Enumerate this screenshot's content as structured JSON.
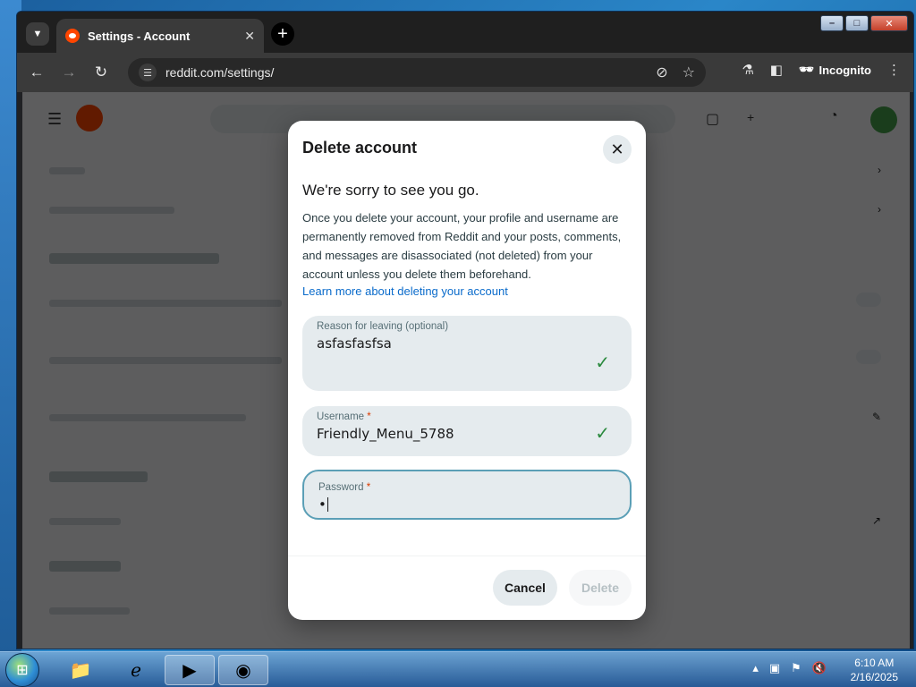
{
  "browser": {
    "tab_title": "Settings - Account",
    "tab_close_glyph": "✕",
    "new_tab_glyph": "+",
    "url": "reddit.com/settings/",
    "incognito_label": "Incognito"
  },
  "modal": {
    "title": "Delete account",
    "close_glyph": "✕",
    "subtitle": "We're sorry to see you go.",
    "description": "Once you delete your account, your profile and username are permanently removed from Reddit and your posts, comments, and messages are disassociated (not deleted) from your account unless you delete them beforehand.",
    "link_text": "Learn more about deleting your account",
    "fields": {
      "reason": {
        "label": "Reason for leaving (optional)",
        "value": "asfasfasfsa",
        "valid": true
      },
      "username": {
        "label": "Username",
        "required_mark": "*",
        "value": "Friendly_Menu_5788",
        "valid": true
      },
      "password": {
        "label": "Password",
        "required_mark": "*",
        "value": "•",
        "focused": true
      }
    },
    "cancel_label": "Cancel",
    "delete_label": "Delete",
    "delete_enabled": false
  },
  "taskbar": {
    "time": "6:10 AM",
    "date": "2/16/2025"
  },
  "colors": {
    "accent_link": "#0a6bcb",
    "check_green": "#2b8a3e",
    "focus_border": "#5b9fb6",
    "reddit_orange": "#ff4500"
  },
  "icons": [
    "tab-list-icon",
    "reddit-favicon-icon",
    "back-arrow-icon",
    "forward-arrow-icon",
    "reload-icon",
    "site-info-icon",
    "eye-off-icon",
    "star-icon",
    "labs-icon",
    "side-panel-icon",
    "incognito-icon",
    "kebab-menu-icon",
    "check-icon",
    "close-icon",
    "start-orb-icon",
    "explorer-icon",
    "ie-icon",
    "media-player-icon",
    "app-icon",
    "volume-mute-icon",
    "network-icon",
    "flag-icon"
  ]
}
